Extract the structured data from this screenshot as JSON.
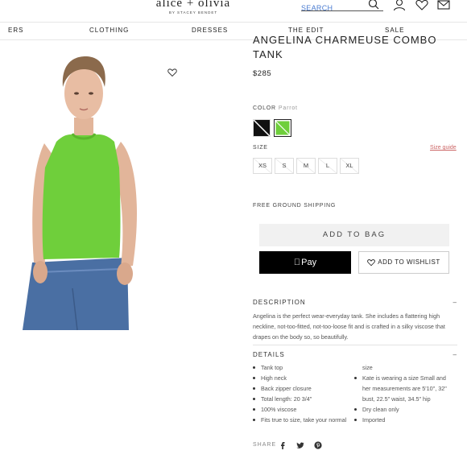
{
  "header": {
    "logo": "alice + olivia",
    "logo_sub": "BY STACEY BENDET",
    "search_placeholder": "SEARCH",
    "icons": [
      "search-icon",
      "account-icon",
      "heart-icon",
      "mail-icon"
    ]
  },
  "nav": {
    "items": [
      "ERS",
      "CLOTHING",
      "DRESSES",
      "THE EDIT",
      "SALE"
    ]
  },
  "product": {
    "title": "ANGELINA CHARMEUSE COMBO TANK",
    "price": "$285",
    "color_label": "COLOR",
    "color_value": "Parrot",
    "swatches": [
      {
        "name": "black-white",
        "color": "#111111"
      },
      {
        "name": "parrot",
        "color": "#6fcf3b"
      }
    ],
    "size_label": "SIZE",
    "size_guide": "Size guide",
    "sizes": [
      "XS",
      "S",
      "M",
      "L",
      "XL"
    ],
    "shipping": "FREE GROUND SHIPPING",
    "add_to_bag": "ADD TO BAG",
    "apple_pay": "Pay",
    "add_to_wishlist": "ADD TO WISHLIST"
  },
  "description": {
    "header": "DESCRIPTION",
    "text": "Angelina is the perfect wear-everyday tank. She includes a flattering high neckline, not-too-fitted, not-too-loose fit and is crafted in a silky viscose that drapes on the body so, so beautifully."
  },
  "details": {
    "header": "DETAILS",
    "left": [
      "Tank top",
      "High neck",
      "Back zipper closure",
      "Total length: 20 3/4\"",
      "100% viscose",
      "Fits true to size, take your normal"
    ],
    "right_cont": "size",
    "right": [
      "Kate is wearing a size Small and her measurements are 5'10\", 32\" bust, 22.5\" waist, 34.5\" hip",
      "Dry clean only",
      "Imported"
    ]
  },
  "share": {
    "label": "SHARE",
    "icons": [
      "facebook-icon",
      "twitter-icon",
      "pinterest-icon"
    ]
  },
  "colors": {
    "accent_link": "#4a7bd0",
    "product_green": "#6fcf3b",
    "size_guide": "#cc6666"
  }
}
